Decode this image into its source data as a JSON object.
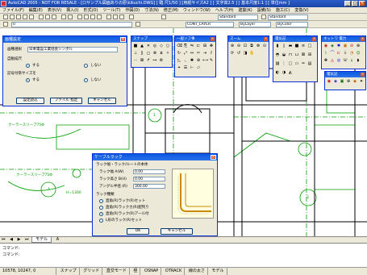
{
  "window": {
    "title": "AutoCAD 2005 - NOT FOR RESALE - [ロサンプル図面ありの原\\kikuchi.DWG] [ 臨 尺1/50 ] [用紙サイズA2 ] [ 文字高2.5 ] [ 基本尺度1:1 ] [ 単位mm ]",
    "min": "_",
    "max": "□",
    "close": "×"
  },
  "menubar": [
    "ファイル(F)",
    "編集(E)",
    "表示(V)",
    "挿入(I)",
    "形式(O)",
    "ツール(T)",
    "作図(D)",
    "寸法(N)",
    "修正(M)",
    "ウィンドウ(W)",
    "ヘルプ(H)",
    "建築(K)",
    "設備(S)",
    "施工(C)",
    "変換(V)"
  ],
  "toolbar": {
    "layer_dropdown": "0",
    "style_dropdown": "Standard",
    "dimstyle_dropdown": "Standard",
    "linetype_dropdown": "CONT_LAYER",
    "lineweight_dropdown": "ByLayer",
    "color_dropdown": "ByColor"
  },
  "palettes": {
    "osnap": {
      "title": "スナップ"
    },
    "modify": {
      "title": "一般ソフ事",
      "close": "×"
    },
    "zoom": {
      "title": "ズーム",
      "close": "×"
    },
    "building": {
      "title": "電気記",
      "close": "×"
    },
    "electric": {
      "title": "ネットワ 電力",
      "close": "×"
    },
    "extra": {
      "title": "電気記",
      "close": "×"
    }
  },
  "drawing": {
    "labels": {
      "duct1": "クーラースリーブ75Φ",
      "duct2": "クーラースリーブ75Φ",
      "h_label": "H=1300",
      "grid_1": "1",
      "grid_2": "2",
      "grid_3": "3",
      "grid_A": "A"
    },
    "accent_color": "#00a000"
  },
  "dialog_settings": {
    "title": "画種設定",
    "close": "×",
    "label_type": "画種選択",
    "type_value": "日本電設工業協会シンボル",
    "label_auto": "自動描尺",
    "auto_yes": "する",
    "auto_no": "しない",
    "label_symbol": "記号付帯サイズを",
    "sym_yes": "する",
    "sym_no": "しない",
    "btn_load": "設定読込",
    "btn_file": "ファイル 指定",
    "btn_cancel": "キャンセル"
  },
  "dialog_cable": {
    "title": "ケーブルラック",
    "close": "×",
    "group_size": "ラック幅・ラック/ルートの本体",
    "label_width": "ラック幅 A(W)",
    "width_value": "0.00",
    "label_height": "ラック高さ B(H)",
    "height_value": "0.00",
    "label_angle": "アングル半径 (R)",
    "angle_value": "300.00",
    "group_type": "ラック種類",
    "options": [
      "直角(R)ラック(R)セット",
      "直角(R)ラックカ(R)配列り",
      "直角(R)ラック(R)アール付",
      "L形のラック(R)セット"
    ],
    "selected_option": 2,
    "ok": "OK",
    "cancel": "キャンセル"
  },
  "tabs": [
    "モデル",
    "A"
  ],
  "command": {
    "line1": "コマンド:",
    "line2": "コマンド:"
  },
  "status": {
    "coords": "10578, 10247, 0",
    "items": [
      "スナップ",
      "グリッド",
      "直交モード",
      "極",
      "OSNAP",
      "OTRACK",
      "線の太さ",
      "モデル"
    ]
  }
}
